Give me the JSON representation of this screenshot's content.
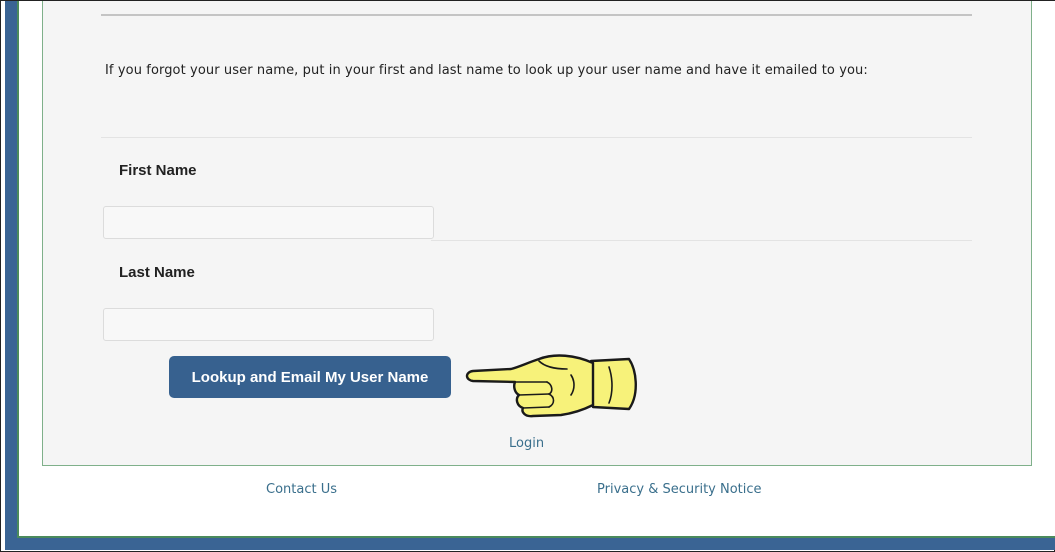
{
  "form": {
    "intro_text": "If you forgot your user name, put in your first and last name to look up your user name and have it emailed to you:",
    "first_name": {
      "label": "First Name",
      "value": "",
      "placeholder": ""
    },
    "last_name": {
      "label": "Last Name",
      "value": "",
      "placeholder": ""
    },
    "submit_label": "Lookup and Email My User Name",
    "login_link": "Login"
  },
  "footer": {
    "contact_link": "Contact Us",
    "privacy_link": "Privacy & Security Notice"
  },
  "annotation": {
    "icon": "pointing-hand-icon",
    "color": "#f7f27a"
  },
  "colors": {
    "accent": "#37618f",
    "link": "#3a6f8c",
    "frame_blue": "#3a6494",
    "frame_green": "#4b8a5c"
  }
}
